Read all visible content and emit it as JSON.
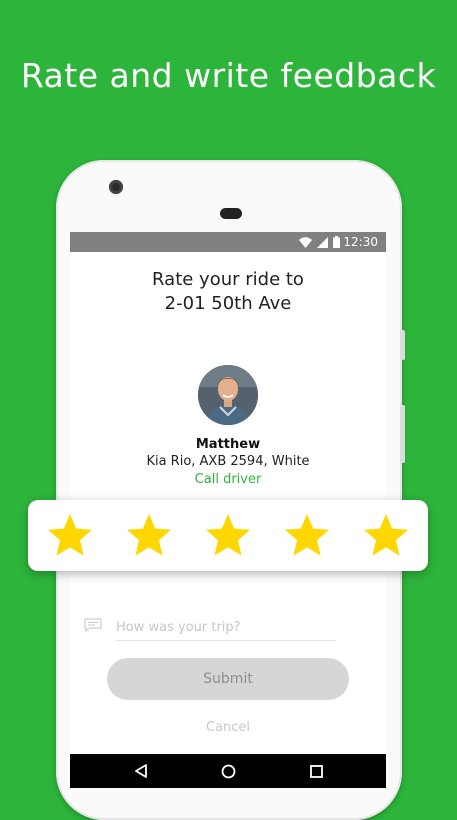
{
  "headline": "Rate and write feedback",
  "status_bar": {
    "time": "12:30"
  },
  "rate": {
    "line1": "Rate your ride to",
    "line2": "2-01 50th Ave"
  },
  "driver": {
    "name": "Matthew",
    "car": "Kia Rio, AXB 2594, White",
    "call_label": "Call driver"
  },
  "rating": {
    "value": 5,
    "max": 5
  },
  "comment": {
    "placeholder": "How was your trip?",
    "value": ""
  },
  "submit_label": "Submit",
  "cancel_label": "Cancel",
  "colors": {
    "brand_green": "#2db53b",
    "star": "#ffd700",
    "button_disabled": "#d6d6d6"
  },
  "icons": [
    "wifi-icon",
    "cell-signal-icon",
    "battery-icon",
    "comment-icon",
    "back-icon",
    "home-icon",
    "recents-icon",
    "star-icon"
  ]
}
